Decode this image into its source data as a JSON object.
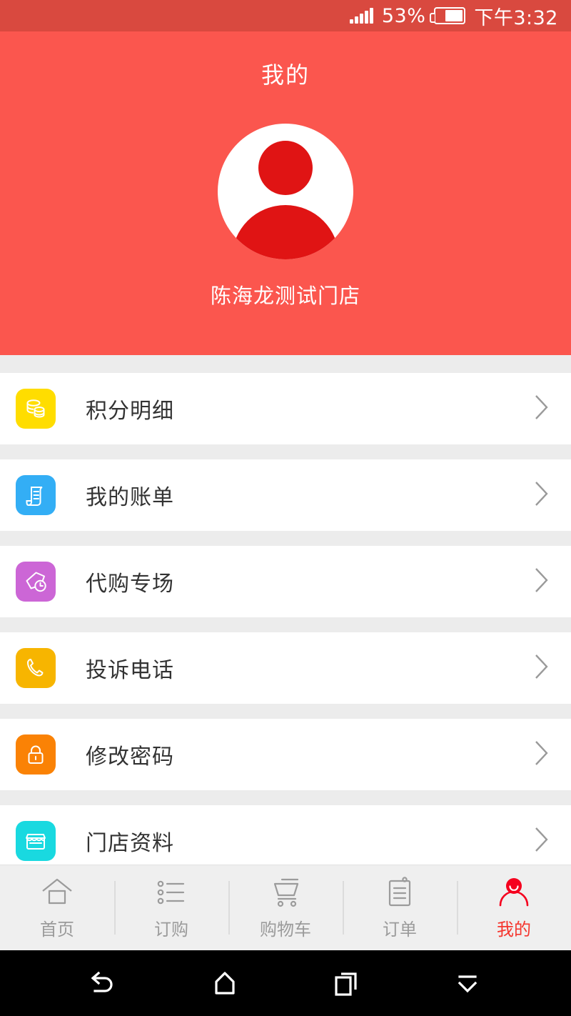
{
  "statusbar": {
    "signal_icon": "signal-bars-icon",
    "battery_percent": "53%",
    "battery_icon": "battery-icon",
    "clock": "下午3:32"
  },
  "header": {
    "title": "我的",
    "avatar_icon": "user-avatar-icon",
    "store_name": "陈海龙测试门店"
  },
  "menu": {
    "chevron_icon": "chevron-right-icon",
    "items": [
      {
        "label": "积分明细",
        "icon": "coins-icon",
        "color": "#ffdd00"
      },
      {
        "label": "我的账单",
        "icon": "bill-scroll-icon",
        "color": "#33aef5"
      },
      {
        "label": "代购专场",
        "icon": "tag-clock-icon",
        "color": "#cc66d6"
      },
      {
        "label": "投诉电话",
        "icon": "phone-icon",
        "color": "#f7b500"
      },
      {
        "label": "修改密码",
        "icon": "lock-icon",
        "color": "#fa8205"
      },
      {
        "label": "门店资料",
        "icon": "storefront-icon",
        "color": "#19d9e0"
      }
    ]
  },
  "tabbar": {
    "active_color": "#f5362e",
    "inactive_color": "#9b9b9b",
    "items": [
      {
        "label": "首页",
        "icon": "home-icon",
        "active": false
      },
      {
        "label": "订购",
        "icon": "list-icon",
        "active": false
      },
      {
        "label": "购物车",
        "icon": "cart-icon",
        "active": false
      },
      {
        "label": "订单",
        "icon": "clipboard-icon",
        "active": false
      },
      {
        "label": "我的",
        "icon": "person-icon",
        "active": true
      }
    ]
  },
  "androidnav": {
    "buttons": [
      {
        "icon": "back-icon"
      },
      {
        "icon": "home-icon"
      },
      {
        "icon": "recents-icon"
      },
      {
        "icon": "hide-navbar-icon"
      }
    ]
  }
}
